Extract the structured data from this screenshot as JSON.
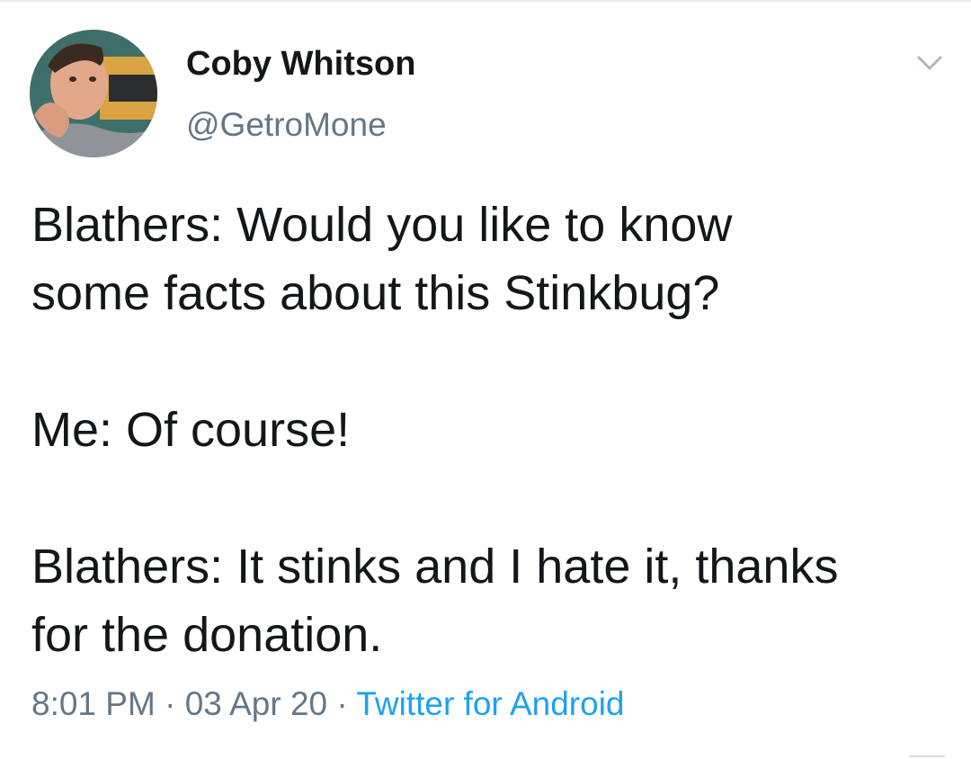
{
  "tweet": {
    "author": {
      "name": "Coby Whitson",
      "handle": "@GetroMone"
    },
    "text_lines": [
      "Blathers: Would you like to know",
      "some facts about this Stinkbug?",
      "Me: Of course!",
      "Blathers: It stinks and I hate it, thanks",
      "for the donation."
    ],
    "meta": {
      "time": "8:01 PM",
      "separator_1": " · ",
      "date": "03 Apr 20",
      "separator_2": " · ",
      "source": "Twitter for Android"
    }
  },
  "icons": {
    "avatar": "profile-photo",
    "caret": "chevron-down-icon"
  },
  "colors": {
    "text": "#14171a",
    "secondary": "#657786",
    "link": "#1da1f2",
    "caret": "#aab8c2"
  }
}
